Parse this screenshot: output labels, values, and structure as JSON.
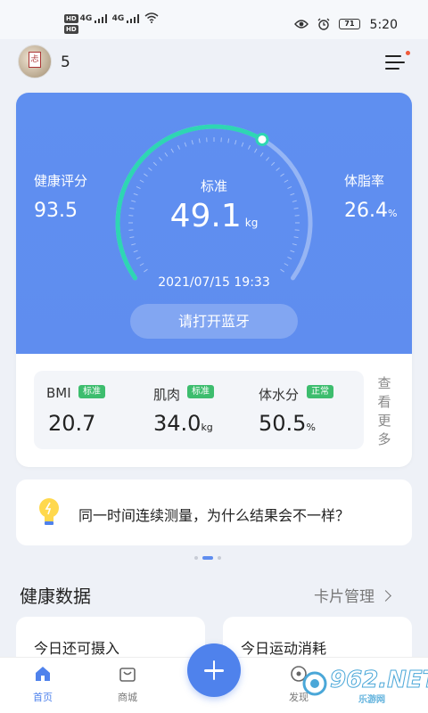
{
  "status_bar": {
    "time": "5:20",
    "battery": "71",
    "network_1": "4G",
    "network_2": "4G",
    "hd_1": "HD",
    "hd_2": "HD"
  },
  "header": {
    "user_name": "5"
  },
  "gauge": {
    "health_score_label": "健康评分",
    "health_score_value": "93.5",
    "body_fat_label": "体脂率",
    "body_fat_value": "26.4",
    "body_fat_unit": "%",
    "status_label": "标准",
    "weight_value": "49.1",
    "weight_unit": "kg",
    "datetime": "2021/07/15 19:33",
    "bluetooth_button": "请打开蓝牙",
    "progress_fraction": 0.62
  },
  "metrics": [
    {
      "name": "BMI",
      "badge": "标准",
      "value": "20.7",
      "unit": ""
    },
    {
      "name": "肌肉",
      "badge": "标准",
      "value": "34.0",
      "unit": "kg"
    },
    {
      "name": "体水分",
      "badge": "正常",
      "value": "50.5",
      "unit": "%"
    }
  ],
  "see_more": "查看更多",
  "tip": {
    "text": "同一时间连续测量，为什么结果会不一样？"
  },
  "section": {
    "title": "健康数据",
    "link": "卡片管理"
  },
  "cards": [
    {
      "label": "今日还可摄入"
    },
    {
      "label": "今日运动消耗"
    }
  ],
  "nav": {
    "home": "首页",
    "shop": "商城",
    "discover": "发现"
  },
  "watermark": {
    "brand": "962.NET",
    "sub": "乐游网"
  },
  "colors": {
    "primary": "#5f8def",
    "gauge_arc": "#2ed6b3",
    "badge_green": "#3dbd6e"
  }
}
